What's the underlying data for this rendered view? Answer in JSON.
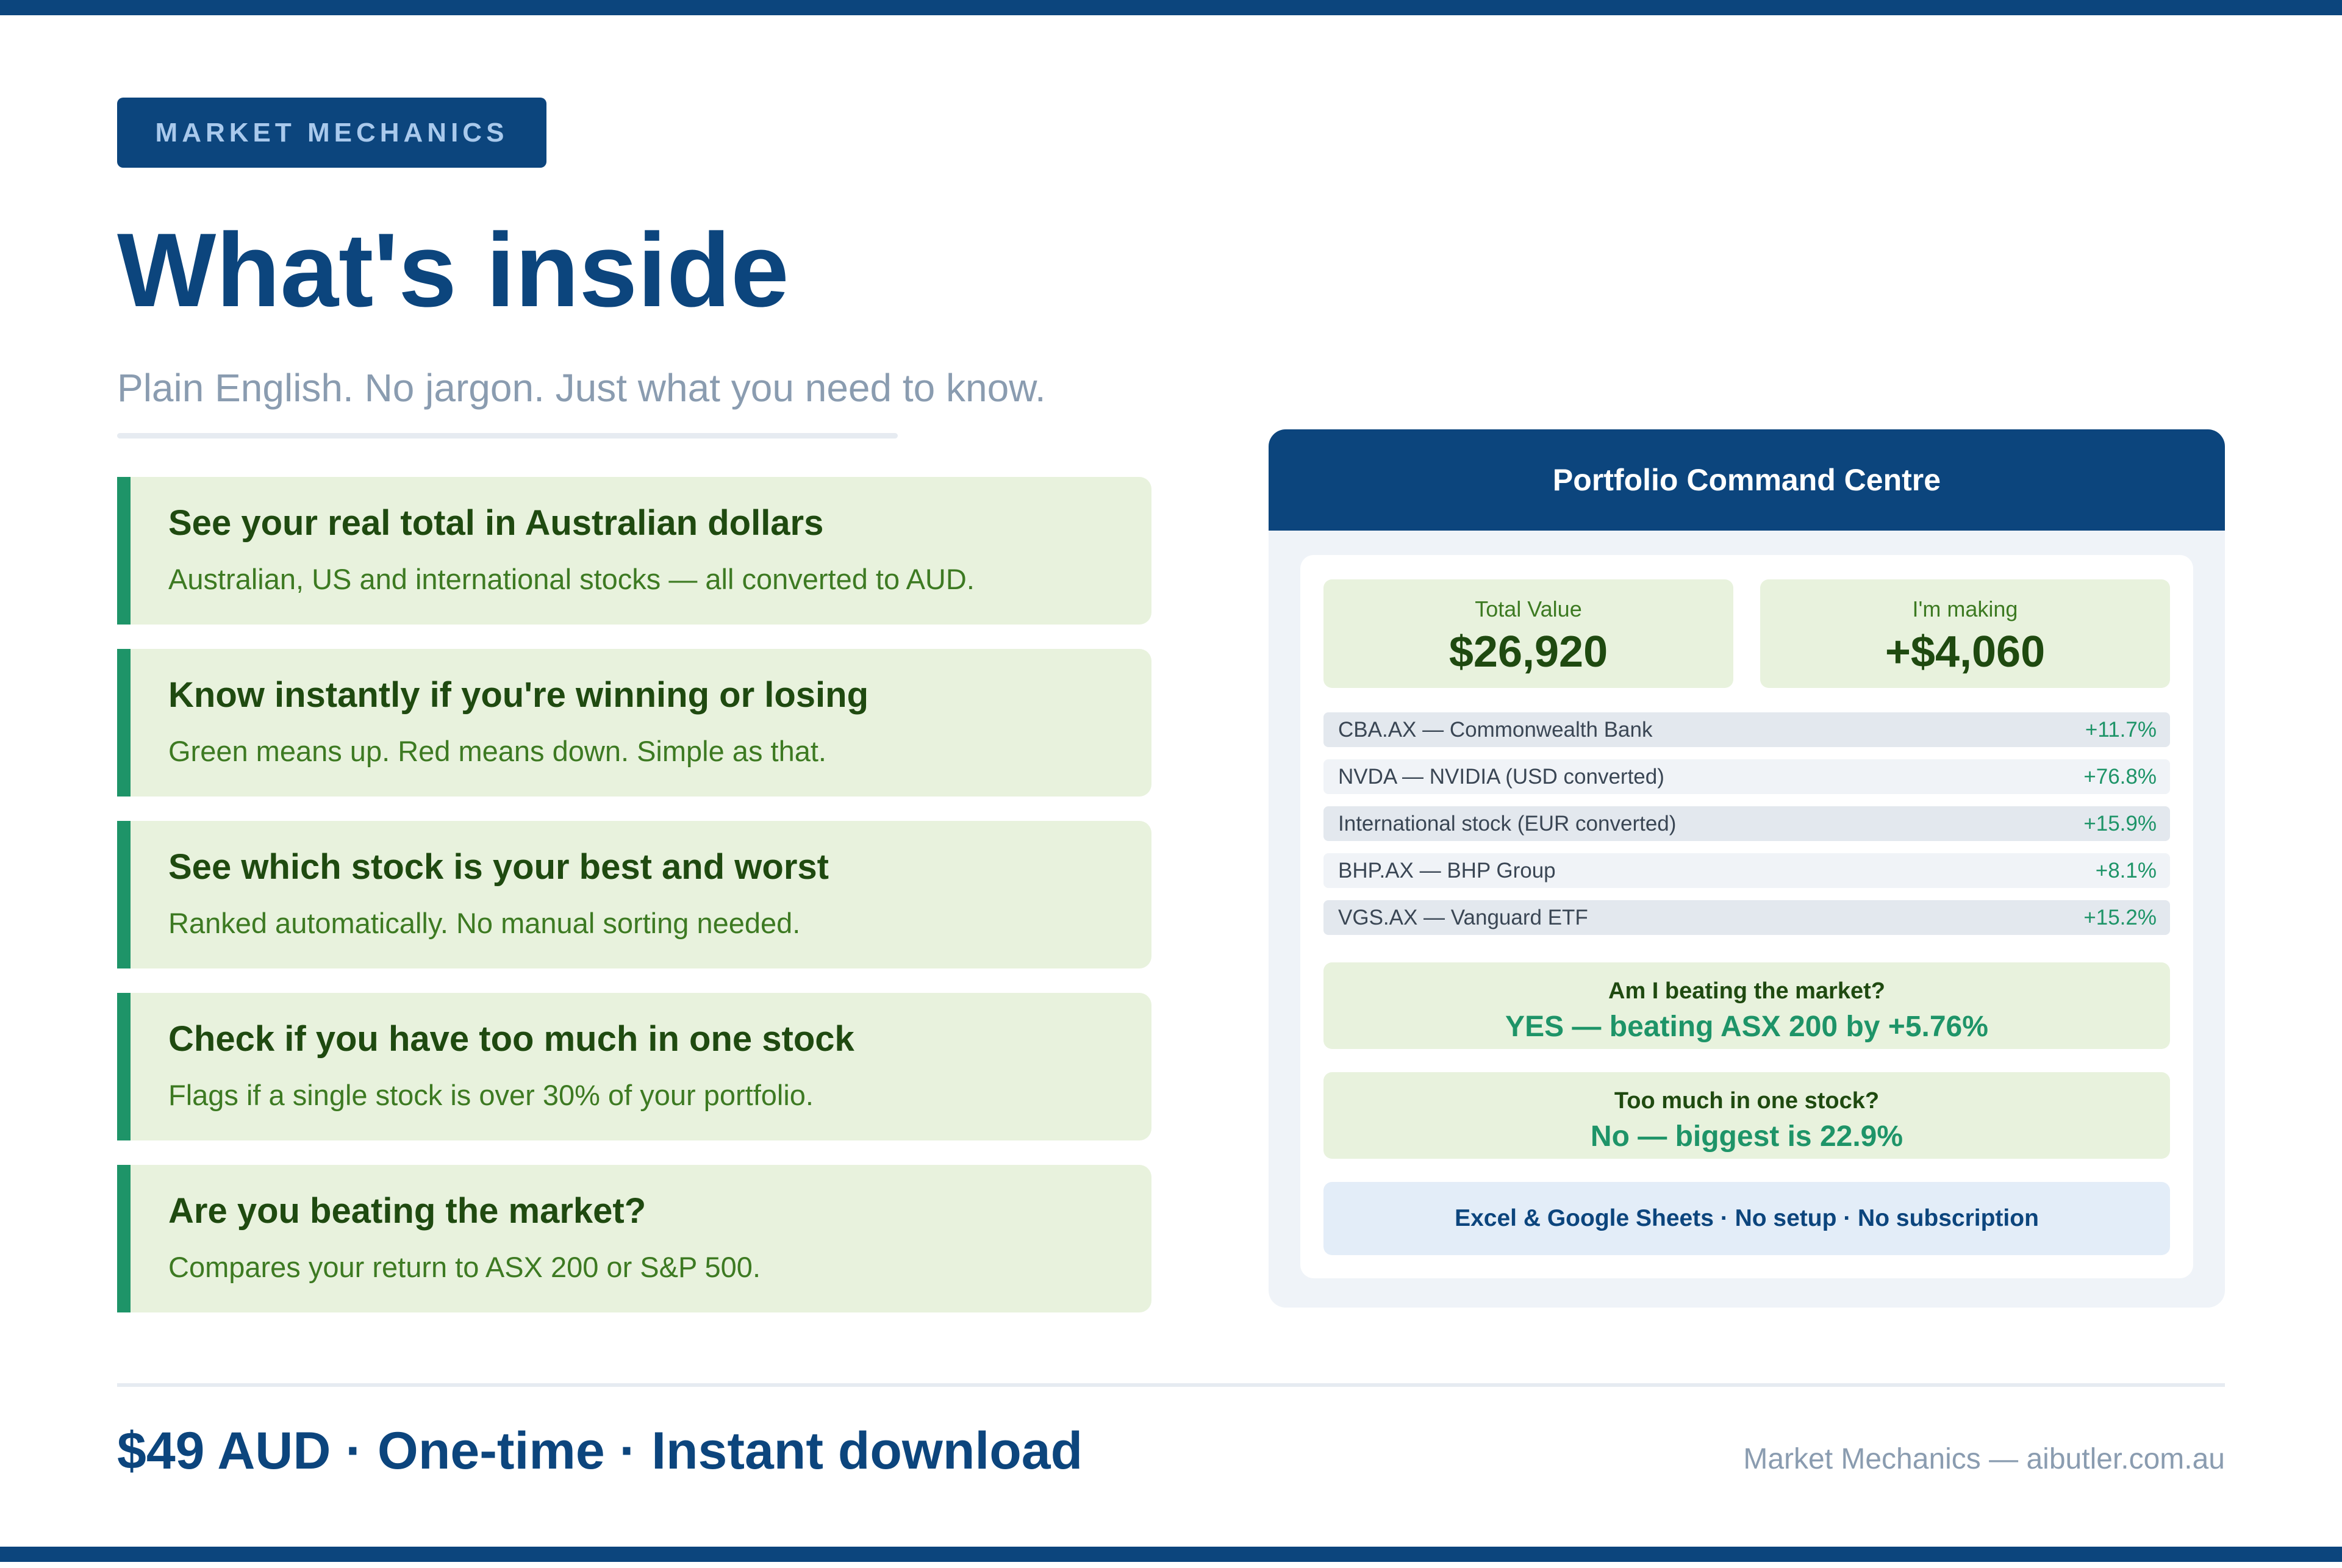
{
  "colors": {
    "brand_navy": "#0c457d",
    "accent_green": "#1e9468",
    "card_green_bg": "#e8f2dd",
    "muted_gray": "#8a9cb0"
  },
  "badge": "MARKET MECHANICS",
  "hero": {
    "title": "What's inside",
    "subtitle": "Plain English. No jargon. Just what you need to know."
  },
  "features": [
    {
      "title": "See your real total in Australian dollars",
      "desc": "Australian, US and international stocks — all converted to AUD."
    },
    {
      "title": "Know instantly if you're winning or losing",
      "desc": "Green means up. Red means down. Simple as that."
    },
    {
      "title": "See which stock is your best and worst",
      "desc": "Ranked automatically. No manual sorting needed."
    },
    {
      "title": "Check if you have too much in one stock",
      "desc": "Flags if a single stock is over 30% of your portfolio."
    },
    {
      "title": "Are you beating the market?",
      "desc": "Compares your return to ASX 200 or S&P 500."
    }
  ],
  "panel": {
    "header": "Portfolio Command Centre",
    "total_value": {
      "label": "Total Value",
      "value": "$26,920"
    },
    "making": {
      "label": "I'm making",
      "value": "+$4,060"
    },
    "holdings": [
      {
        "name": "CBA.AX — Commonwealth Bank",
        "change": "+11.7%"
      },
      {
        "name": "NVDA — NVIDIA (USD converted)",
        "change": "+76.8%"
      },
      {
        "name": "International stock (EUR converted)",
        "change": "+15.9%"
      },
      {
        "name": "BHP.AX — BHP Group",
        "change": "+8.1%"
      },
      {
        "name": "VGS.AX — Vanguard ETF",
        "change": "+15.2%"
      }
    ],
    "market_check": {
      "question": "Am I beating the market?",
      "answer": "YES — beating ASX 200 by +5.76%"
    },
    "concentration_check": {
      "question": "Too much in one stock?",
      "answer": "No — biggest is 22.9%"
    },
    "cta": "Excel & Google Sheets · No setup · No subscription"
  },
  "footer": {
    "price": "$49 AUD · One-time · Instant download",
    "credit": "Market Mechanics — aibutler.com.au"
  }
}
